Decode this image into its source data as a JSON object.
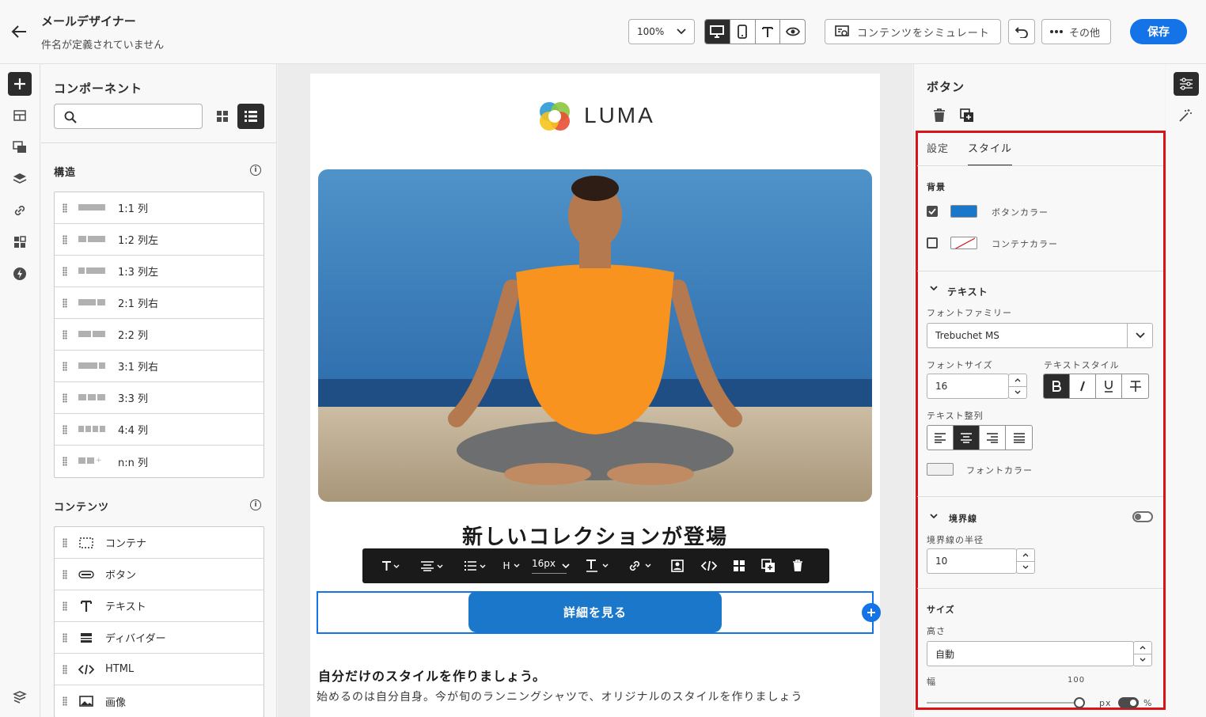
{
  "header": {
    "title": "メールデザイナー",
    "subtitle": "件名が定義されていません",
    "zoom": "100%",
    "simulate_label": "コンテンツをシミュレート",
    "more_label": "その他",
    "save_label": "保存"
  },
  "components": {
    "title": "コンポーネント",
    "search_placeholder": "",
    "structure_heading": "構造",
    "structure_items": [
      {
        "label": "1:1 列"
      },
      {
        "label": "1:2 列左"
      },
      {
        "label": "1:3 列左"
      },
      {
        "label": "2:1 列右"
      },
      {
        "label": "2:2 列"
      },
      {
        "label": "3:1 列右"
      },
      {
        "label": "3:3 列"
      },
      {
        "label": "4:4 列"
      },
      {
        "label": "n:n 列"
      }
    ],
    "content_heading": "コンテンツ",
    "content_items": [
      {
        "label": "コンテナ",
        "icon": "container-icon"
      },
      {
        "label": "ボタン",
        "icon": "button-icon"
      },
      {
        "label": "テキスト",
        "icon": "text-icon"
      },
      {
        "label": "ディバイダー",
        "icon": "divider-icon"
      },
      {
        "label": "HTML",
        "icon": "code-icon"
      },
      {
        "label": "画像",
        "icon": "image-icon"
      }
    ]
  },
  "email": {
    "logo_text": "LUMA",
    "heading": "新しいコレクションが登場",
    "cta_label": "詳細を見る",
    "subheading": "自分だけのスタイルを作りましょう。",
    "body": "始めるのは自分自身。今が旬のランニングシャツで、オリジナルのスタイルを作りましょう"
  },
  "toolbar": {
    "font_size": "16px",
    "heading_label": "H"
  },
  "props": {
    "title": "ボタン",
    "tabs": [
      "設定",
      "スタイル"
    ],
    "active_tab": "スタイル",
    "background_heading": "背景",
    "button_color_label": "ボタンカラー",
    "button_color": "#1a77c9",
    "button_color_checked": true,
    "container_color_label": "コンテナカラー",
    "container_color_checked": false,
    "text_heading": "テキスト",
    "font_family_label": "フォントファミリー",
    "font_family": "Trebuchet MS",
    "font_size_label": "フォントサイズ",
    "font_size": "16",
    "text_style_label": "テキストスタイル",
    "text_align_label": "テキスト整列",
    "font_color_label": "フォントカラー",
    "border_heading": "境界線",
    "border_radius_label": "境界線の半径",
    "border_radius": "10",
    "size_heading": "サイズ",
    "height_label": "高さ",
    "height_value": "自動",
    "width_label": "幅",
    "width_value": "100",
    "unit_px": "px",
    "unit_pct": "%"
  }
}
